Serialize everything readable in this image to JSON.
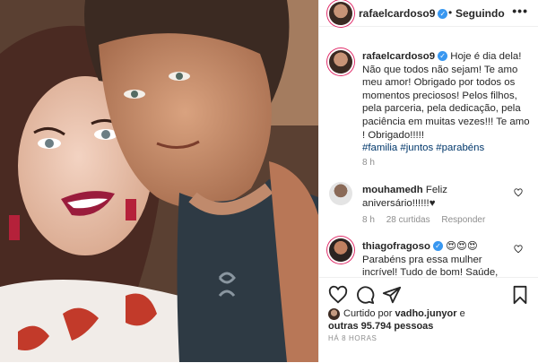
{
  "header": {
    "username": "rafaelcardoso9",
    "separator": "•",
    "follow_status": "Seguindo",
    "more": "•••"
  },
  "caption": {
    "username": "rafaelcardoso9",
    "text": "Hoje é dia dela! Não que todos não sejam! Te amo meu amor! Obrigado por todos os momentos preciosos! Pelos filhos, pela parceria, pela dedicação, pela paciência em muitas vezes!!! Te amo ! Obrigado!!!!!",
    "hashtags": "#familia #juntos #parabéns",
    "time": "8 h"
  },
  "comments": [
    {
      "username": "mouhamedh",
      "text": "Feliz aniversário!!!!!!♥",
      "time": "8 h",
      "likes": "28 curtidas",
      "reply": "Responder"
    },
    {
      "username": "thiagofragoso",
      "text": "😍😍😍 Parabéns pra essa mulher incrível! Tudo de bom! Saúde, alegrias,"
    }
  ],
  "liked_by": {
    "prefix": "Curtido por",
    "user": "vadho.junyor",
    "conj": "e",
    "others": "outras 95.794 pessoas"
  },
  "post_age": "HÁ 8 HORAS",
  "icons": [
    "heart-icon",
    "comment-icon",
    "share-icon",
    "bookmark-icon",
    "more-icon",
    "verified-icon"
  ]
}
